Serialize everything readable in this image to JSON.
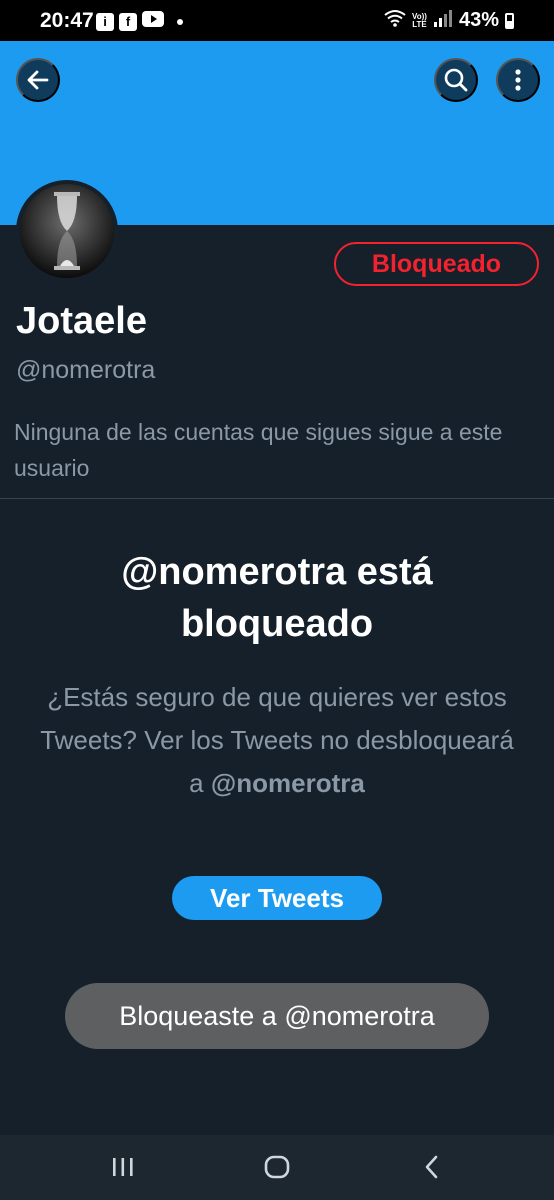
{
  "status_bar": {
    "time": "20:47",
    "battery_percent": "43%",
    "volte": "Vo)) LTE",
    "notification_icons": [
      "info-icon",
      "facebook-icon",
      "youtube-icon"
    ]
  },
  "profile": {
    "display_name": "Jotaele",
    "handle": "@nomerotra",
    "blocked_button_label": "Bloqueado",
    "followers_note": "Ninguna de las cuentas que sigues sigue a este usuario"
  },
  "blocked_notice": {
    "title": "@nomerotra está bloqueado",
    "desc_prefix": "¿Estás seguro de que quieres ver estos Tweets? Ver los Tweets no desbloqueará a",
    "desc_handle": "@nomerotra",
    "view_button_label": "Ver Tweets"
  },
  "toast": {
    "message": "Bloqueaste a @nomerotra"
  },
  "colors": {
    "banner": "#1d9bf0",
    "background": "#15202b",
    "blocked_red": "#f4212e",
    "secondary_text": "#8b98a5",
    "accent": "#1d9bf0"
  }
}
